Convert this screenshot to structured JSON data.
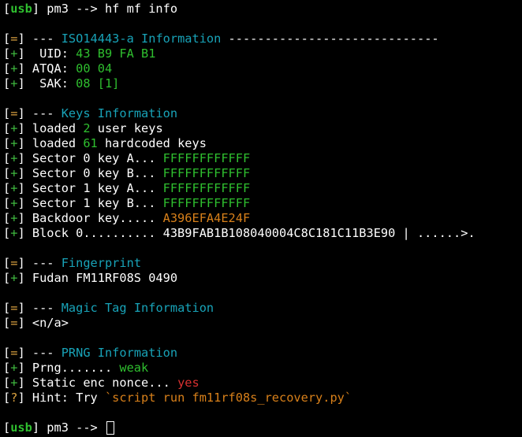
{
  "prompt": {
    "usb": "usb",
    "pm3": " pm3 --> ",
    "command": "hf mf info",
    "final_pm3": " pm3 --> "
  },
  "iso": {
    "header_prefix": " --- ",
    "header_title": "ISO14443-a Information",
    "header_rule": " -----------------------------",
    "uid_label": "  UID: ",
    "uid_value": "43 B9 FA B1",
    "atqa_label": " ATQA: ",
    "atqa_value": "00 04",
    "sak_label": "  SAK: ",
    "sak_value": "08 [1]"
  },
  "keys": {
    "header_prefix": " --- ",
    "header_title": "Keys Information",
    "loaded_user_pre": " loaded ",
    "loaded_user_count": "2",
    "loaded_user_post": " user keys",
    "loaded_hc_pre": " loaded ",
    "loaded_hc_count": "61",
    "loaded_hc_post": " hardcoded keys",
    "sector_lines": [
      {
        "label": " Sector 0 key A... ",
        "value": "FFFFFFFFFFFF"
      },
      {
        "label": " Sector 0 key B... ",
        "value": "FFFFFFFFFFFF"
      },
      {
        "label": " Sector 1 key A... ",
        "value": "FFFFFFFFFFFF"
      },
      {
        "label": " Sector 1 key B... ",
        "value": "FFFFFFFFFFFF"
      }
    ],
    "backdoor_label": " Backdoor key..... ",
    "backdoor_value": "A396EFA4E24F",
    "block_label": " Block 0.......... ",
    "block_value": "43B9FAB1B108040004C8C181C11B3E90 | ......>."
  },
  "fingerprint": {
    "header_prefix": " --- ",
    "header_title": "Fingerprint",
    "value": " Fudan FM11RF08S 0490"
  },
  "magic": {
    "header_prefix": " --- ",
    "header_title": "Magic Tag Information",
    "value": " <n/a>"
  },
  "prng": {
    "header_prefix": " --- ",
    "header_title": "PRNG Information",
    "prng_label": " Prng....... ",
    "prng_value": "weak",
    "nonce_label": " Static enc nonce... ",
    "nonce_value": "yes",
    "hint_label": " Hint: Try ",
    "hint_value": "`script run fm11rf08s_recovery.py`"
  },
  "markers": {
    "info": "=",
    "success": "+",
    "hint": "?"
  },
  "colors": {
    "background": "#000000",
    "green": "#2fbf2f",
    "cyan": "#18a3b8",
    "orange": "#d8801a",
    "red": "#d83030",
    "yellow_marker": "#d8a040"
  }
}
